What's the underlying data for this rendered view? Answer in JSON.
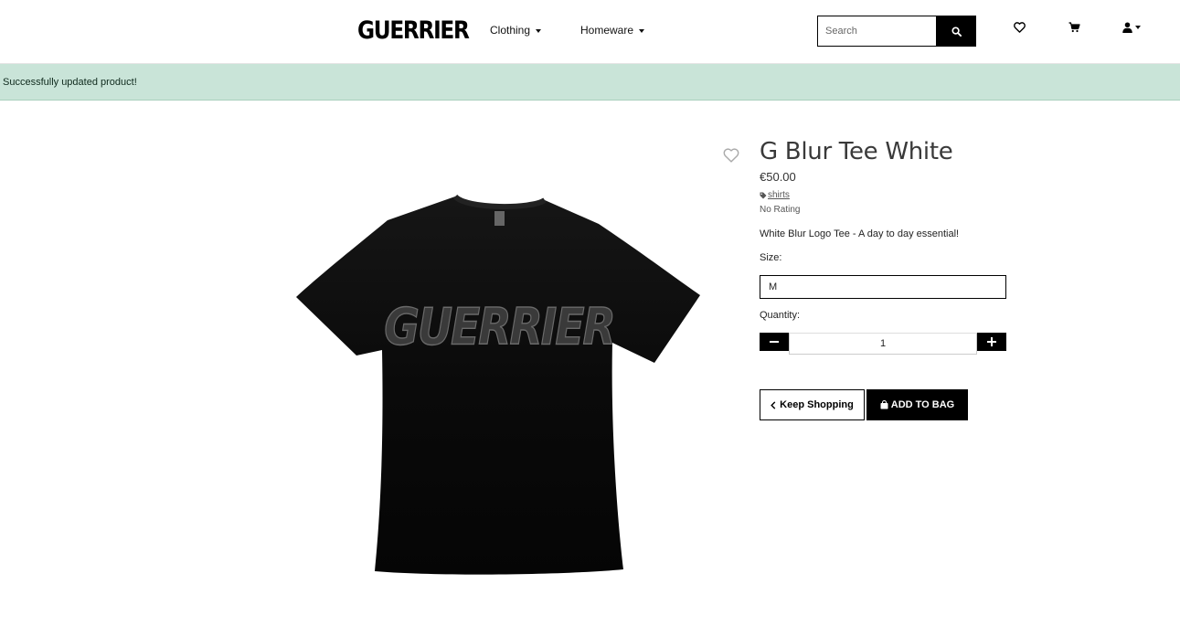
{
  "header": {
    "logo": "GUERRIER",
    "nav": [
      {
        "label": "Clothing"
      },
      {
        "label": "Homeware"
      }
    ],
    "search": {
      "placeholder": "Search",
      "value": ""
    },
    "icons": [
      "heart-icon",
      "cart-icon",
      "user-icon"
    ]
  },
  "alert": {
    "message": "Successfully updated product!",
    "color": "#c9e4d8"
  },
  "product": {
    "image_text": "GUERRIER",
    "title": "G Blur Tee White",
    "price": "€50.00",
    "category": "shirts",
    "rating": "No Rating",
    "description": "White Blur Logo Tee - A day to day essential!",
    "size_label": "Size:",
    "size_value": "M",
    "quantity_label": "Quantity:",
    "quantity": "1"
  },
  "actions": {
    "keep_shopping": "Keep Shopping",
    "add_to_bag": "ADD TO BAG"
  }
}
